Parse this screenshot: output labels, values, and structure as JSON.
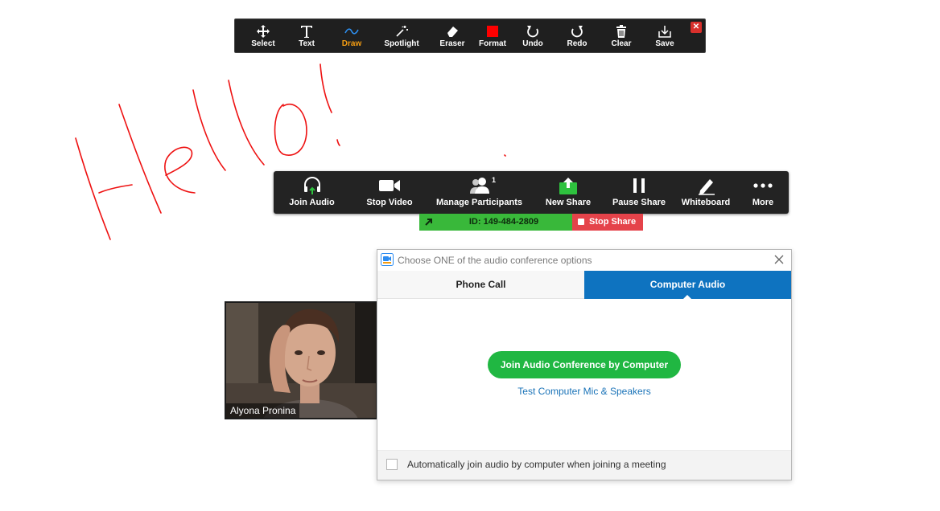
{
  "annotation_toolbar": {
    "tools": [
      {
        "label": "Select",
        "icon": "move-arrows-icon"
      },
      {
        "label": "Text",
        "icon": "text-t-icon"
      },
      {
        "label": "Draw",
        "icon": "squiggle-icon"
      },
      {
        "label": "Spotlight",
        "icon": "magic-wand-icon"
      },
      {
        "label": "Eraser",
        "icon": "eraser-icon"
      },
      {
        "label": "Format",
        "icon": "color-square-icon"
      },
      {
        "label": "Undo",
        "icon": "undo-icon"
      },
      {
        "label": "Redo",
        "icon": "redo-icon"
      },
      {
        "label": "Clear",
        "icon": "trash-icon"
      },
      {
        "label": "Save",
        "icon": "download-icon"
      }
    ],
    "active_tool": "Draw",
    "format_color": "#ff0000",
    "close_icon": "close-icon"
  },
  "drawing": {
    "ink_color": "#ee1111",
    "icon": "hello-handwriting"
  },
  "meeting_toolbar": {
    "items": [
      {
        "label": "Join Audio",
        "icon": "headphones-icon"
      },
      {
        "label": "Stop Video",
        "icon": "video-camera-icon"
      },
      {
        "label": "Manage Participants",
        "icon": "participants-icon",
        "badge": "1"
      },
      {
        "label": "New Share",
        "icon": "share-screen-icon"
      },
      {
        "label": "Pause Share",
        "icon": "pause-icon"
      },
      {
        "label": "Whiteboard",
        "icon": "pencil-icon"
      },
      {
        "label": "More",
        "icon": "more-dots-icon"
      }
    ]
  },
  "share_bar": {
    "meeting_id": "ID: 149-484-2809",
    "stop_label": "Stop Share",
    "id_color": "#39b83a",
    "stop_color": "#e5434a"
  },
  "video": {
    "participant_name": "Alyona Pronina"
  },
  "audio_dialog": {
    "title": "Choose ONE of the audio conference options",
    "tabs": [
      {
        "label": "Phone Call",
        "selected": false
      },
      {
        "label": "Computer Audio",
        "selected": true
      }
    ],
    "join_button": "Join Audio Conference by Computer",
    "test_link": "Test Computer Mic & Speakers",
    "auto_join_label": "Automatically join audio by computer when joining a meeting",
    "auto_join_checked": false,
    "accent_color": "#0e73c0",
    "join_color": "#20b742"
  }
}
